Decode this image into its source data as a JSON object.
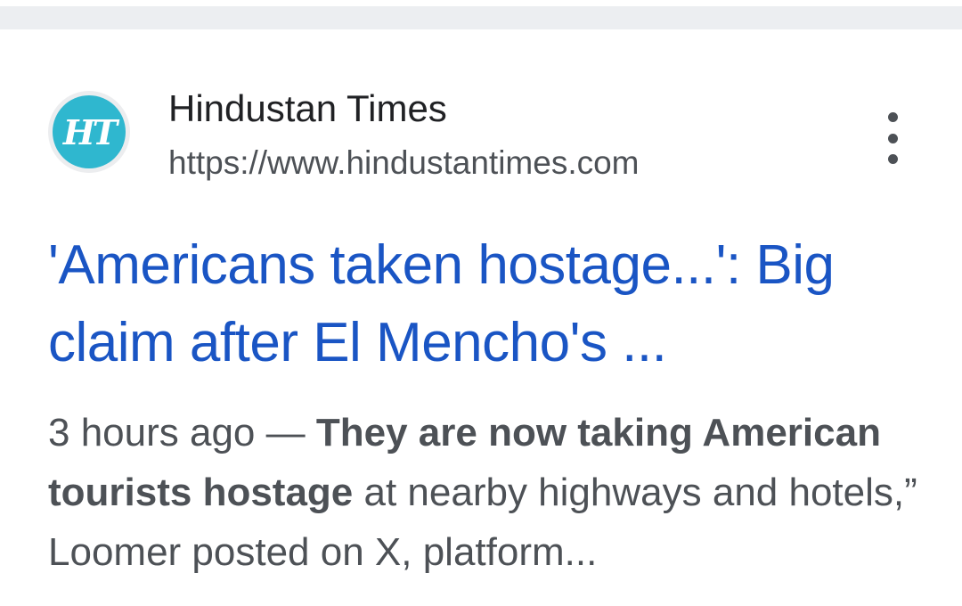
{
  "result": {
    "site_name": "Hindustan Times",
    "url": "https://www.hindustantimes.com",
    "favicon": {
      "text": "HT",
      "icon": "hindustan-times-logo-icon",
      "color": "#2fb7cf"
    },
    "more_icon": "more-vert-icon",
    "title": "'Americans taken hostage...': Big claim after El Mencho's ...",
    "snippet": {
      "date": "3 hours ago",
      "separator": " — ",
      "highlight": "They are now taking American tourists hostage",
      "rest": " at nearby highways and hotels,” Loomer posted on X, platform..."
    }
  },
  "colors": {
    "link": "#1a55c4",
    "site_name": "#202124",
    "secondary": "#4d5156",
    "divider": "#eceef1"
  }
}
